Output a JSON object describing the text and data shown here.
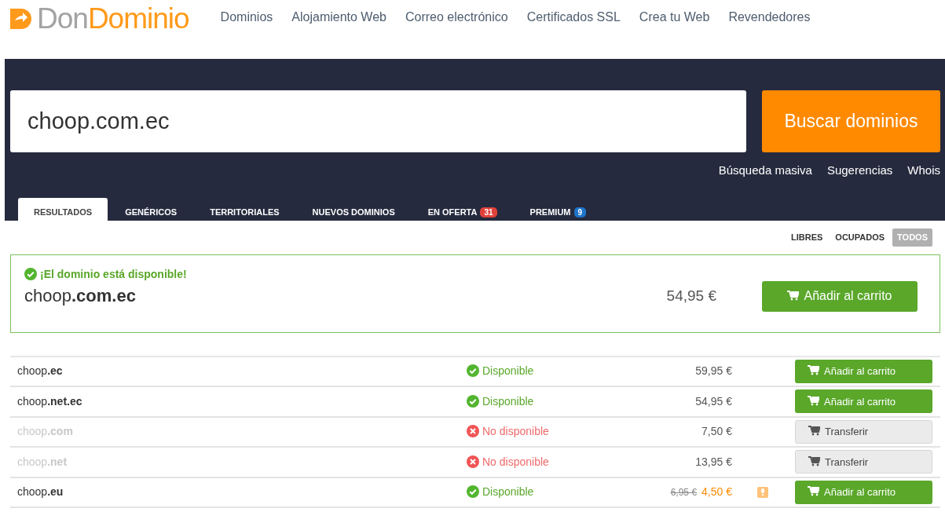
{
  "logo": {
    "part_1": "Don",
    "part_2": "Dominio"
  },
  "nav": [
    "Dominios",
    "Alojamiento Web",
    "Correo electrónico",
    "Certificados SSL",
    "Crea tu Web",
    "Revendedores"
  ],
  "search": {
    "value": "choop.com.ec",
    "button": "Buscar dominios"
  },
  "search_links": [
    "Búsqueda masiva",
    "Sugerencias",
    "Whois"
  ],
  "tabs": [
    {
      "label": "RESULTADOS",
      "selected": true
    },
    {
      "label": "GENÉRICOS",
      "selected": false
    },
    {
      "label": "TERRITORIALES",
      "selected": false
    },
    {
      "label": "NUEVOS DOMINIOS",
      "selected": false
    },
    {
      "label": "EN OFERTA",
      "selected": false,
      "badge": "31",
      "color": "#e0413b"
    },
    {
      "label": "PREMIUM",
      "selected": false,
      "badge": "9",
      "color": "#1e74c9"
    }
  ],
  "filters": [
    {
      "label": "LIBRES",
      "selected": false
    },
    {
      "label": "OCUPADOS",
      "selected": false
    },
    {
      "label": "TODOS",
      "selected": true
    }
  ],
  "featured": {
    "headline": "¡El dominio está disponible!",
    "domain": "choop**.com.ec**",
    "price": "54,95 €",
    "button": "Añadir al carrito"
  },
  "rows": [
    {
      "domain": "choop**.ec**",
      "available": true,
      "status": "Disponible",
      "price": "59,95 €",
      "button": "Añadir al carrito"
    },
    {
      "domain": "choop**.net.ec**",
      "available": true,
      "status": "Disponible",
      "price": "54,95 €",
      "button": "Añadir al carrito"
    },
    {
      "domain": "choop**.com**",
      "available": false,
      "status": "No disponible",
      "price": "7,50 €",
      "button": "Transferir"
    },
    {
      "domain": "choop**.net**",
      "available": false,
      "status": "No disponible",
      "price": "13,95 €",
      "button": "Transferir"
    },
    {
      "domain": "choop**.eu**",
      "available": true,
      "status": "Disponible",
      "old_price": "6,95 €",
      "price": "4,50 €",
      "promo": true,
      "button": "Añadir al carrito"
    }
  ]
}
